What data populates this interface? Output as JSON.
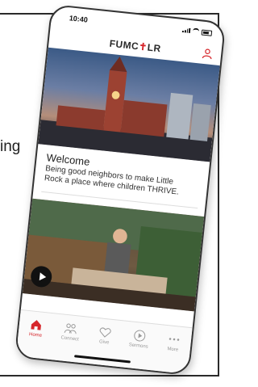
{
  "page": {
    "fragment_text": "ing"
  },
  "phone": {
    "status_bar": {
      "time": "10:40"
    },
    "header": {
      "logo_text_a": "FUMC",
      "logo_text_b": "LR",
      "logo_cross": "✝"
    },
    "welcome": {
      "title": "Welcome",
      "body": "Being good neighbors to make Little Rock a place where children THRIVE."
    },
    "tabs": [
      {
        "label": "Home",
        "icon": "home-icon",
        "active": true
      },
      {
        "label": "Connect",
        "icon": "people-icon",
        "active": false
      },
      {
        "label": "Give",
        "icon": "heart-icon",
        "active": false
      },
      {
        "label": "Sermons",
        "icon": "play-circle-icon",
        "active": false
      },
      {
        "label": "More",
        "icon": "more-icon",
        "active": false
      }
    ],
    "colors": {
      "accent": "#d6262b"
    }
  }
}
